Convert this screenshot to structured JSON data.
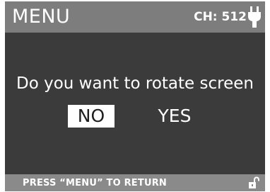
{
  "header": {
    "title": "MENU",
    "channel": "CH: 512",
    "channel_icon": "plug-icon"
  },
  "dialog": {
    "prompt": "Do you want to rotate screen",
    "options": [
      {
        "label": "NO",
        "selected": true
      },
      {
        "label": "YES",
        "selected": false
      }
    ]
  },
  "footer": {
    "hint": "PRESS “MENU” TO RETURN",
    "lock_icon": "unlocked-padlock-icon"
  },
  "colors": {
    "header_bg": "#7d7d7d",
    "body_bg": "#3b3b3b",
    "footer_bg": "#8a8a8a",
    "text": "#ffffff",
    "selected_bg": "#ffffff",
    "selected_text": "#1e1e1e"
  }
}
